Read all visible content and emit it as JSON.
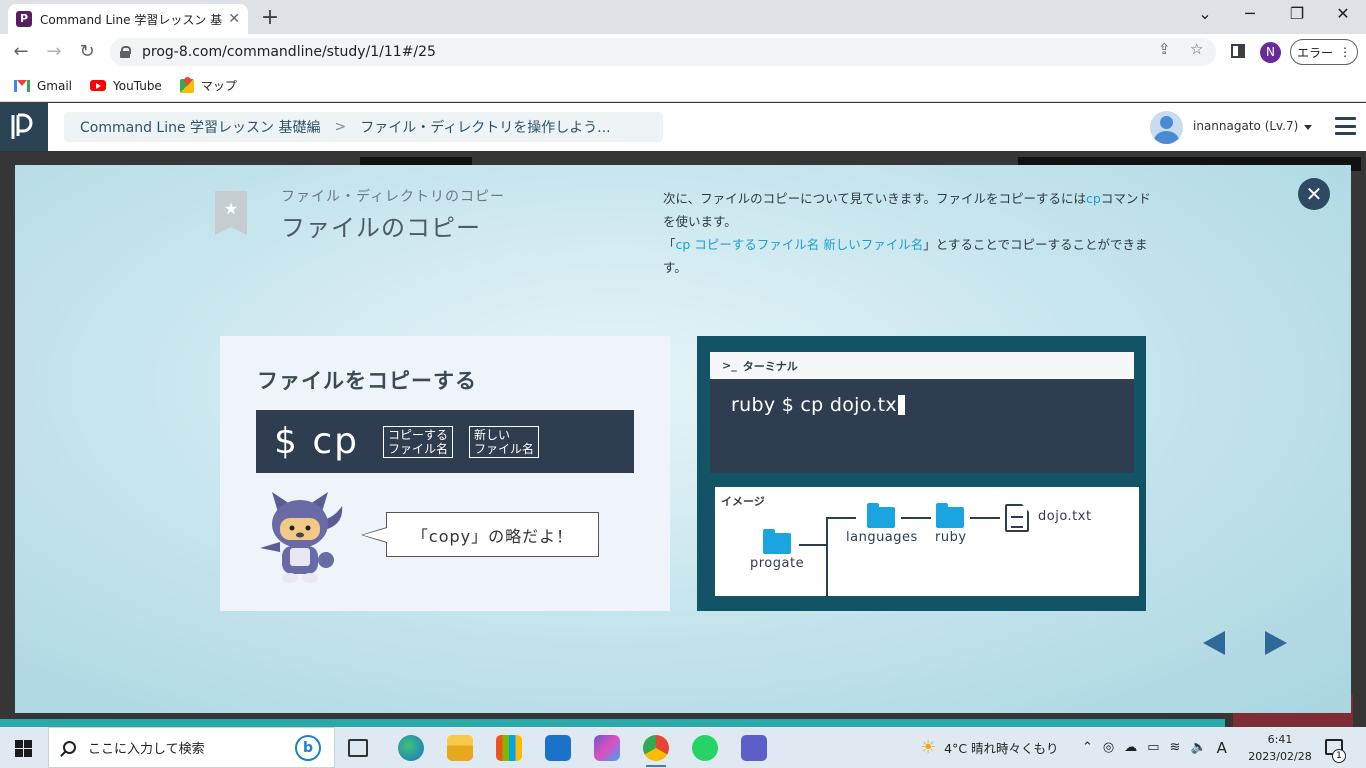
{
  "browser": {
    "tab_title": "Command Line 学習レッスン 基礎編",
    "tab_favicon": "P",
    "url": "prog-8.com/commandline/study/1/11#/25",
    "profile_initial": "N",
    "error_label": "エラー",
    "bookmarks": [
      {
        "label": "Gmail",
        "icon": "gmail-icon"
      },
      {
        "label": "YouTube",
        "icon": "youtube-icon"
      },
      {
        "label": "マップ",
        "icon": "maps-icon"
      }
    ]
  },
  "header": {
    "breadcrumb": [
      "Command Line 学習レッスン 基礎編",
      "ファイル・ディレクトリを操作しよう..."
    ],
    "user": "inannagato (Lv.7)"
  },
  "slide": {
    "subtitle": "ファイル・ディレクトリのコピー",
    "title": "ファイルのコピー",
    "desc_line1": "次に、ファイルのコピーについて見ていきます。ファイルをコピーするには",
    "desc_cmd": "cp",
    "desc_line1b": "コマンドを使います。",
    "desc_q_open": "「",
    "desc_syntax": "cp コピーするファイル名 新しいファイル名",
    "desc_q_close": "」とすることでコピーすることができます。",
    "card_heading": "ファイルをコピーする",
    "cmd": "$ cp",
    "arg1_l1": "コピーする",
    "arg1_l2": "ファイル名",
    "arg2_l1": "新しい",
    "arg2_l2": "ファイル名",
    "speech": "「copy」の略だよ！",
    "terminal_title": "ターミナル",
    "terminal_prompt": ">_",
    "terminal_line": "ruby $ cp dojo.tx",
    "image_label": "イメージ",
    "tree": {
      "root": "progate",
      "child": "languages",
      "grandchild": "ruby",
      "file": "dojo.txt"
    }
  },
  "taskbar": {
    "search_placeholder": "ここに入力して検索",
    "weather": "4°C  晴れ時々くもり",
    "ime": "A",
    "time": "6:41",
    "date": "2023/02/28",
    "notifications": "1"
  },
  "colors": {
    "accent": "#1aa0cf",
    "dark_navy": "#2e3d50",
    "terminal_frame": "#125466"
  }
}
